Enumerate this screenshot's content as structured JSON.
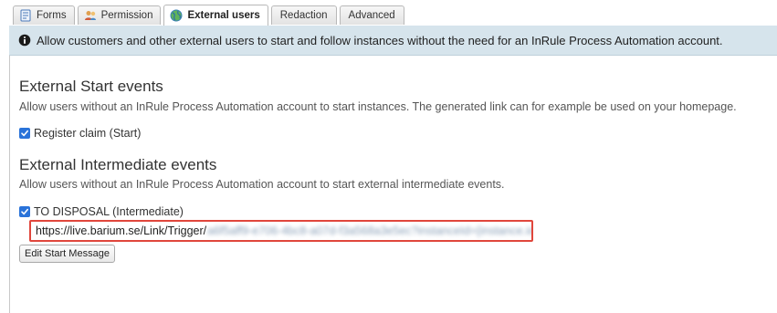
{
  "tabs": [
    {
      "label": "Forms",
      "icon": "form-icon",
      "active": false
    },
    {
      "label": "Permission",
      "icon": "users-icon",
      "active": false
    },
    {
      "label": "External users",
      "icon": "globe-icon",
      "active": true
    },
    {
      "label": "Redaction",
      "icon": "",
      "active": false
    },
    {
      "label": "Advanced",
      "icon": "",
      "active": false
    }
  ],
  "info": {
    "icon": "info-icon",
    "text": "Allow customers and other external users to start and follow instances without the need for an InRule Process Automation account."
  },
  "start_events": {
    "heading": "External Start events",
    "description": "Allow users without an InRule Process Automation account to start instances. The generated link can for example be used on your homepage.",
    "items": [
      {
        "label": "Register claim (Start)",
        "checked": true
      }
    ]
  },
  "intermediate_events": {
    "heading": "External Intermediate events",
    "description": "Allow users without an InRule Process Automation account to start external intermediate events.",
    "items": [
      {
        "label": "TO DISPOSAL (Intermediate)",
        "checked": true
      }
    ],
    "link_url": "https://live.barium.se/Link/Trigger/",
    "link_url_redacted": "a6f5aff9-e706-4bc8-a07d-f3a568a3e5ec?instanceId={instance.id}",
    "edit_button_label": "Edit Start Message"
  },
  "colors": {
    "info_bar": "#d6e4ec",
    "checkbox": "#2a73d9",
    "highlight_border": "#e0463c"
  }
}
